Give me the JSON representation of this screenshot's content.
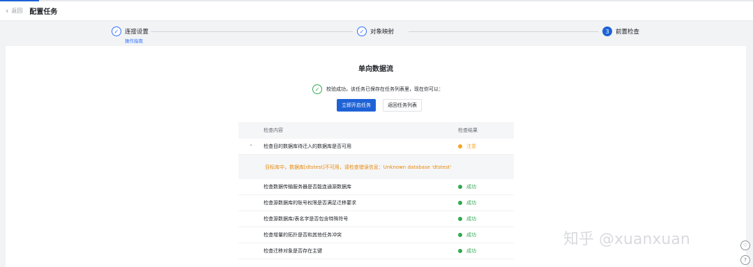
{
  "header": {
    "back_label": "返回",
    "title": "配置任务"
  },
  "steps": [
    {
      "label": "连接设置",
      "sub": "操作指南",
      "state": "done"
    },
    {
      "label": "对象映射",
      "state": "done"
    },
    {
      "label": "前置检查",
      "number": "3",
      "state": "active"
    }
  ],
  "main": {
    "flow_title": "单向数据流",
    "success_message": "校验成功，该任务已保存在任务列表里，现在你可以：",
    "primary_button": "立即开启任务",
    "secondary_button": "返回任务列表"
  },
  "table": {
    "columns": [
      "检查内容",
      "检查结果"
    ],
    "expanded_row": {
      "name": "检查目的数据库待迁入的数据库是否可用",
      "result": "注意",
      "status": "warning"
    },
    "detail": "目标库中，数据库[dtstest]不可用，请检查错误信息：Unknown database 'dtstest'",
    "rows": [
      {
        "name": "检查数据传输服务器是否能连通源数据库",
        "result": "成功"
      },
      {
        "name": "检查源数据库的账号权限是否满足迁移要求",
        "result": "成功"
      },
      {
        "name": "检查源数据库/表名字是否包含特殊符号",
        "result": "成功"
      },
      {
        "name": "检查增量的拓扑是否和其他任务冲突",
        "result": "成功"
      },
      {
        "name": "检查迁移对象是否存在主键",
        "result": "成功"
      }
    ]
  },
  "watermark": "知乎 @xuanxuan",
  "colors": {
    "primary": "#1e62d6",
    "success": "#34a853",
    "warning": "#f5a623"
  },
  "icons": {
    "back": "chevron-left-icon",
    "done_step": "check-circle-icon",
    "collapse": "chevron-up-icon",
    "feedback": "heart-icon",
    "help": "question-icon"
  }
}
